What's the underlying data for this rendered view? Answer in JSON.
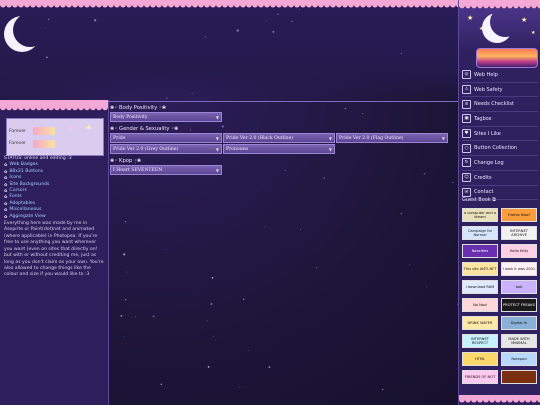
{
  "colors": {
    "sky": "#1b1433",
    "panel": "#2e1f5c",
    "accent": "#7a63b0",
    "link": "#9fd0ff",
    "lace": "#f3a8d6"
  },
  "profile": {
    "forever_label_1": "Forever",
    "forever_label_2": "Forever"
  },
  "left": {
    "status": "STATUS: online and editing :3",
    "links": [
      "Web Badges",
      "88x31 Buttons",
      "Icons",
      "Site Backgrounds",
      "Cursors",
      "Fonts",
      "Adoptables",
      "Miscellaneous",
      "Aggregate View"
    ],
    "note": "Everything here was made by me in Aseprite or Paint(dot)net and animated (where applicable) in Photopea. If you're free to use anything you want wherever you want (even on sites that directly on! but with or without crediting me, just as long as you don't claim as your own. You're also allowed to change things like the colour and size if you would like to :3"
  },
  "main": {
    "sections": [
      {
        "title": "❀◦ Body Positivity ◦❀",
        "buttons": [
          "Body Positivity"
        ]
      },
      {
        "title": "❀◦ Gender & Sexuality ◦❀",
        "buttons": [
          "Pride",
          "Pride Ver 2.0 (Black Outline)",
          "Pride Ver 2.0 (Flag Outline)",
          "Pride Ver 2.0 (Grey Outline)",
          "Pronouns"
        ]
      },
      {
        "title": "❀◦ Kpop ◦❀",
        "buttons": [
          "I Heart SEVENTEEN"
        ]
      }
    ]
  },
  "nav": {
    "items": [
      {
        "icon": "globe-icon",
        "glyph": "◎",
        "label": "Web Help"
      },
      {
        "icon": "warning-icon",
        "glyph": "⚠",
        "label": "Web Safety"
      },
      {
        "icon": "list-icon",
        "glyph": "≡",
        "label": "Needs Checklist"
      },
      {
        "icon": "tag-icon",
        "glyph": "▣",
        "label": "Tagbox"
      },
      {
        "icon": "heart-icon",
        "glyph": "♥",
        "label": "Sites I Like"
      },
      {
        "icon": "button-icon",
        "glyph": "○",
        "label": "Button Collection"
      },
      {
        "icon": "refresh-icon",
        "glyph": "↻",
        "label": "Change Log"
      },
      {
        "icon": "people-icon",
        "glyph": "☺",
        "label": "Credits"
      },
      {
        "icon": "mail-icon",
        "glyph": "✉",
        "label": "Contact"
      }
    ],
    "guestbook": "Guest Book ⧉"
  },
  "stamps": [
    {
      "text": "a computer and a dream",
      "bg": "#e8e0b8"
    },
    {
      "text": "Firefox Now!",
      "bg": "#ff9d3c"
    },
    {
      "text": "Campaign for Normal",
      "bg": "#d6e6ff"
    },
    {
      "text": "INTERNET ARCHIVE",
      "bg": "#f2f2f2"
    },
    {
      "text": "Neocities",
      "bg": "#6a2fb0"
    },
    {
      "text": "Hello Kitty",
      "bg": "#ffd0e5"
    },
    {
      "text": "This site ANTI-NFT",
      "bg": "#ffe6a0"
    },
    {
      "text": "I wish it was 2001",
      "bg": "#fff1f5"
    },
    {
      "text": "I download RAM",
      "bg": "#e0eaff"
    },
    {
      "text": "bob",
      "bg": "#c9b3ff"
    },
    {
      "text": "No Nazi",
      "bg": "#ffd9d9"
    },
    {
      "text": "PROTECT FREAKS",
      "bg": "#1a1a1a"
    },
    {
      "text": "DRINK WATER",
      "bg": "#ffe9a8"
    },
    {
      "text": "Digital Hi",
      "bg": "#8bb0d8"
    },
    {
      "text": "INTERNET RESPECT",
      "bg": "#c8f0ff"
    },
    {
      "text": "MADE WITH MINIMAL",
      "bg": "#e6e6e6"
    },
    {
      "text": "HTML",
      "bg": "#ffd86b"
    },
    {
      "text": "Notepad",
      "bg": "#b8d8ff"
    },
    {
      "text": "FRIENDS OF NOT",
      "bg": "#ffc9f0"
    },
    {
      "text": "",
      "bg": "#7a3010"
    }
  ]
}
